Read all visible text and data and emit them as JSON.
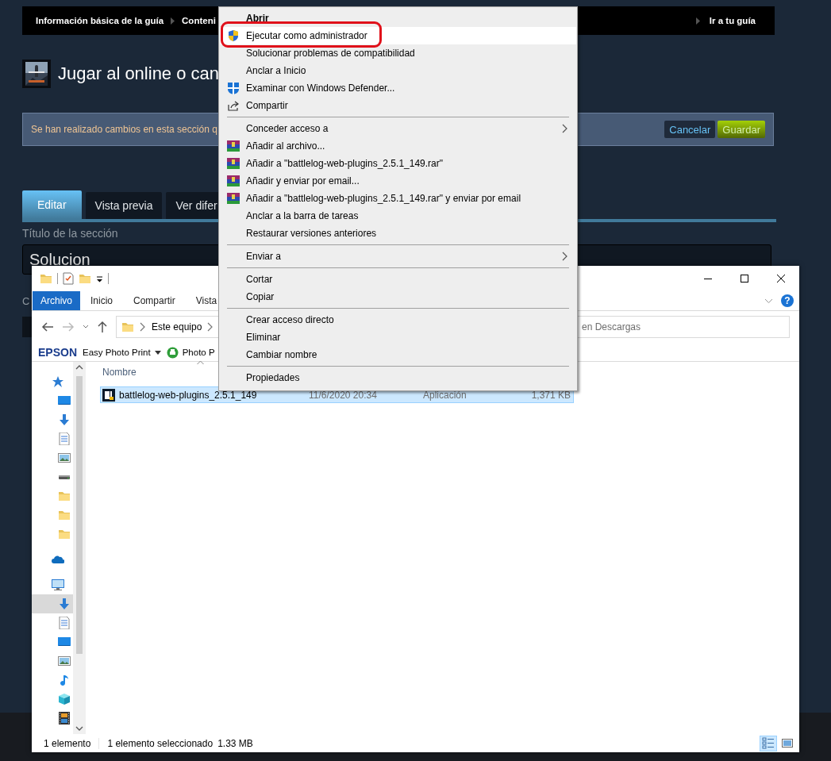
{
  "guide_page": {
    "nav": {
      "breadcrumbs": [
        "Información básica de la guía",
        "Conteni"
      ],
      "link": "Ir a tu guía"
    },
    "title": "Jugar al online o can",
    "notice": {
      "text": "Se han realizado cambios en esta sección q",
      "buttons": [
        {
          "label": "Cancelar",
          "kind": "cancel"
        },
        {
          "label": "Guardar",
          "kind": "save"
        }
      ]
    },
    "tabs": [
      {
        "label": "Editar",
        "selected": true
      },
      {
        "label": "Vista previa",
        "selected": false
      },
      {
        "label": "Ver difer",
        "selected": false
      }
    ],
    "section_title": {
      "label": "Título de la sección",
      "value": "Solucion"
    },
    "content_label": "C"
  },
  "explorer": {
    "ribbon_tabs": [
      {
        "label": "Archivo",
        "kind": "file"
      },
      {
        "label": "Inicio",
        "kind": "tab"
      },
      {
        "label": "Compartir",
        "kind": "tab"
      },
      {
        "label": "Vista",
        "kind": "tab"
      }
    ],
    "help": "?",
    "address": [
      "Este equipo"
    ],
    "search": {
      "placeholder": "en Descargas"
    },
    "toolbar": {
      "brand": "EPSON",
      "items": [
        {
          "label": "Easy Photo Print",
          "kind": "dropdown"
        },
        {
          "label": "Photo P",
          "kind": "printer"
        }
      ]
    },
    "nav_tree": [
      {
        "kind": "star",
        "selected": false,
        "children": [
          {
            "kind": "desktop",
            "selected": false
          },
          {
            "kind": "download",
            "selected": false
          },
          {
            "kind": "document",
            "selected": false
          },
          {
            "kind": "picture",
            "selected": false
          },
          {
            "kind": "drive",
            "selected": false
          },
          {
            "kind": "folder",
            "selected": false
          },
          {
            "kind": "folder",
            "selected": false
          },
          {
            "kind": "folder",
            "selected": false
          }
        ]
      },
      {
        "kind": "cloud",
        "selected": false
      },
      {
        "kind": "computer",
        "selected": false,
        "children": [
          {
            "kind": "download",
            "selected": true
          },
          {
            "kind": "document",
            "selected": false
          },
          {
            "kind": "desktop",
            "selected": false
          },
          {
            "kind": "picture",
            "selected": false
          },
          {
            "kind": "music",
            "selected": false
          },
          {
            "kind": "cube",
            "selected": false
          },
          {
            "kind": "film",
            "selected": false
          }
        ]
      }
    ],
    "columns": [
      "Nombre"
    ],
    "files": [
      {
        "name": "battlelog-web-plugins_2.5.1_149",
        "date": "11/6/2020 20:34",
        "type": "Aplicación",
        "size": "1,371 KB",
        "selected": true
      }
    ],
    "status": {
      "count": "1 elemento",
      "selection": "1 elemento seleccionado",
      "size": "1.33 MB"
    },
    "views": [
      {
        "kind": "details",
        "selected": true
      },
      {
        "kind": "large_icons",
        "selected": false
      }
    ]
  },
  "context_menu": {
    "items": [
      {
        "kind": "plain",
        "label": "Abrir",
        "default": true,
        "selected": false,
        "circled": false,
        "submenu": false
      },
      {
        "kind": "shield",
        "label": "Ejecutar como administrador",
        "default": false,
        "selected": true,
        "circled": true,
        "submenu": false
      },
      {
        "kind": "plain",
        "label": "Solucionar problemas de compatibilidad",
        "default": false,
        "selected": false,
        "circled": false,
        "submenu": false
      },
      {
        "kind": "plain",
        "label": "Anclar a Inicio",
        "default": false,
        "selected": false,
        "circled": false,
        "submenu": false
      },
      {
        "kind": "defender",
        "label": "Examinar con Windows Defender...",
        "default": false,
        "selected": false,
        "circled": false,
        "submenu": false
      },
      {
        "kind": "share",
        "label": "Compartir",
        "default": false,
        "selected": false,
        "circled": false,
        "submenu": false
      },
      {
        "kind": "separator"
      },
      {
        "kind": "plain",
        "label": "Conceder acceso a",
        "default": false,
        "selected": false,
        "circled": false,
        "submenu": true
      },
      {
        "kind": "archive",
        "label": "Añadir al archivo...",
        "default": false,
        "selected": false,
        "circled": false,
        "submenu": false
      },
      {
        "kind": "archive",
        "label": "Añadir a \"battlelog-web-plugins_2.5.1_149.rar\"",
        "default": false,
        "selected": false,
        "circled": false,
        "submenu": false
      },
      {
        "kind": "archive",
        "label": "Añadir y enviar por email...",
        "default": false,
        "selected": false,
        "circled": false,
        "submenu": false
      },
      {
        "kind": "archive",
        "label": "Añadir a \"battlelog-web-plugins_2.5.1_149.rar\" y enviar por email",
        "default": false,
        "selected": false,
        "circled": false,
        "submenu": false
      },
      {
        "kind": "plain",
        "label": "Anclar a la barra de tareas",
        "default": false,
        "selected": false,
        "circled": false,
        "submenu": false
      },
      {
        "kind": "plain",
        "label": "Restaurar versiones anteriores",
        "default": false,
        "selected": false,
        "circled": false,
        "submenu": false
      },
      {
        "kind": "separator"
      },
      {
        "kind": "plain",
        "label": "Enviar a",
        "default": false,
        "selected": false,
        "circled": false,
        "submenu": true
      },
      {
        "kind": "separator"
      },
      {
        "kind": "plain",
        "label": "Cortar",
        "default": false,
        "selected": false,
        "circled": false,
        "submenu": false
      },
      {
        "kind": "plain",
        "label": "Copiar",
        "default": false,
        "selected": false,
        "circled": false,
        "submenu": false
      },
      {
        "kind": "separator"
      },
      {
        "kind": "plain",
        "label": "Crear acceso directo",
        "default": false,
        "selected": false,
        "circled": false,
        "submenu": false
      },
      {
        "kind": "plain",
        "label": "Eliminar",
        "default": false,
        "selected": false,
        "circled": false,
        "submenu": false
      },
      {
        "kind": "plain",
        "label": "Cambiar nombre",
        "default": false,
        "selected": false,
        "circled": false,
        "submenu": false
      },
      {
        "kind": "separator"
      },
      {
        "kind": "plain",
        "label": "Propiedades",
        "default": false,
        "selected": false,
        "circled": false,
        "submenu": false
      }
    ]
  }
}
